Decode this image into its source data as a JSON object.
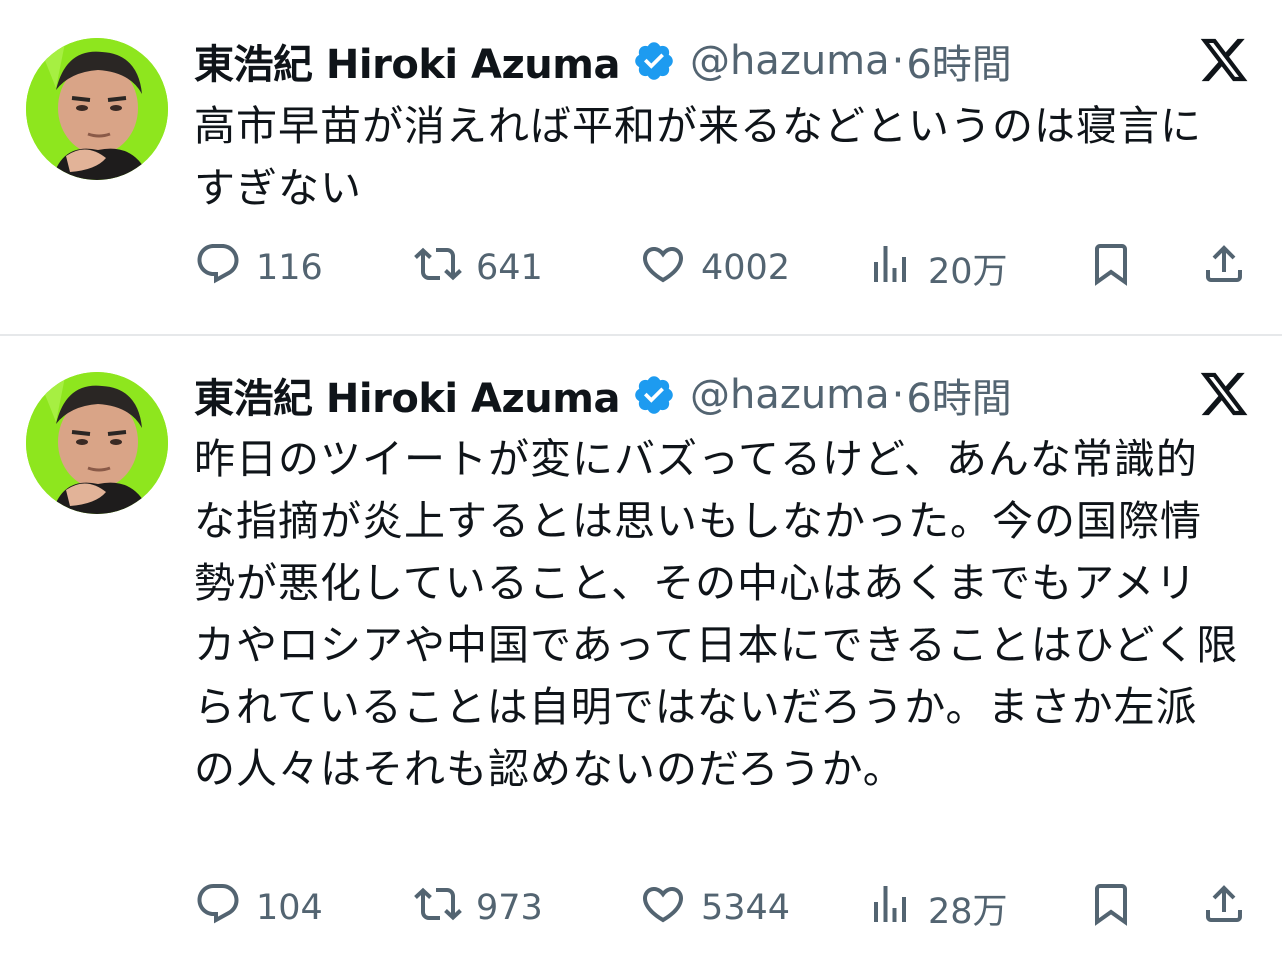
{
  "tweets": [
    {
      "author_name": "東浩紀 Hiroki Azuma",
      "handle": "@hazuma",
      "separator": "·",
      "time": "6時間",
      "text": "高市早苗が消えれば平和が来るなどというのは寝言にすぎない",
      "replies": "116",
      "reposts": "641",
      "likes": "4002",
      "views": "20万"
    },
    {
      "author_name": "東浩紀 Hiroki Azuma",
      "handle": "@hazuma",
      "separator": "·",
      "time": "6時間",
      "text": "昨日のツイートが変にバズってるけど、あんな常識的な指摘が炎上するとは思いもしなかった。今の国際情勢が悪化していること、その中心はあくまでもアメリカやロシアや中国であって日本にできることはひどく限られていることは自明ではないだろうか。まさか左派の人々はそれも認めないのだろうか。",
      "replies": "104",
      "reposts": "973",
      "likes": "5344",
      "views": "28万"
    }
  ],
  "icons": {
    "verified": "verified-badge-icon",
    "x_logo": "x-logo-icon",
    "reply": "reply-icon",
    "repost": "repost-icon",
    "like": "heart-icon",
    "views": "views-icon",
    "bookmark": "bookmark-icon",
    "share": "share-icon"
  },
  "colors": {
    "verified_blue": "#1d9bf0",
    "muted": "#536471",
    "text": "#0f1419",
    "avatar_bg": "#8ee61e"
  }
}
